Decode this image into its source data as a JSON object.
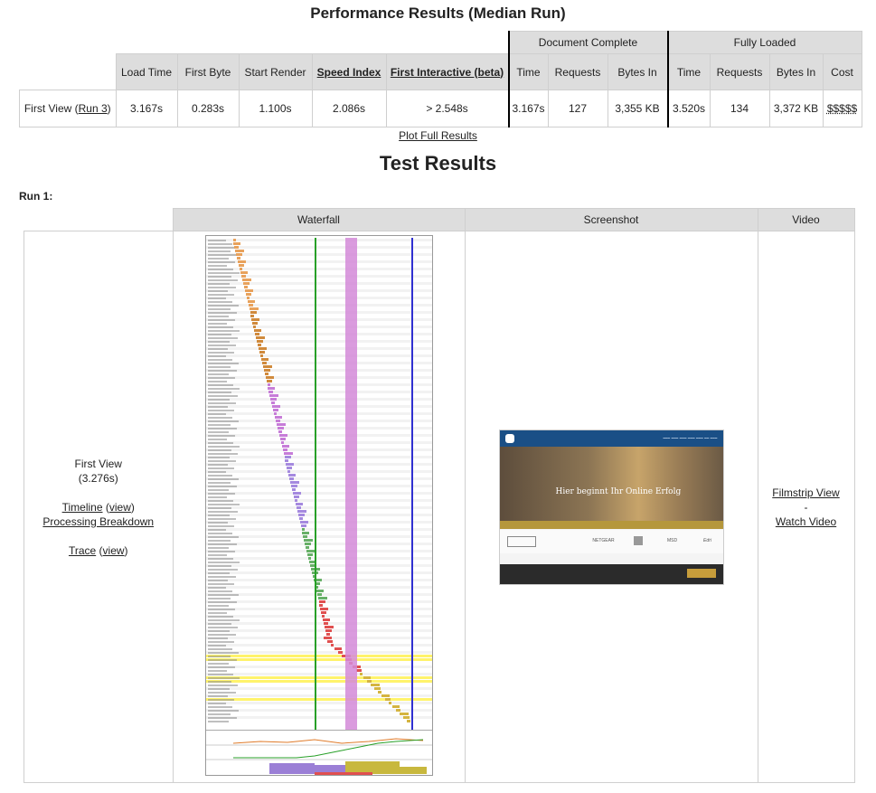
{
  "perf": {
    "title": "Performance Results (Median Run)",
    "group_document": "Document Complete",
    "group_fully": "Fully Loaded",
    "headers": {
      "load_time": "Load Time",
      "first_byte": "First Byte",
      "start_render": "Start Render",
      "speed_index": "Speed Index",
      "first_interactive": "First Interactive (beta)",
      "doc_time": "Time",
      "doc_requests": "Requests",
      "doc_bytes": "Bytes In",
      "fl_time": "Time",
      "fl_requests": "Requests",
      "fl_bytes": "Bytes In",
      "cost": "Cost"
    },
    "row": {
      "label_prefix": "First View (",
      "label_link": "Run 3",
      "label_suffix": ")",
      "load_time": "3.167s",
      "first_byte": "0.283s",
      "start_render": "1.100s",
      "speed_index": "2.086s",
      "first_interactive": "> 2.548s",
      "doc_time": "3.167s",
      "doc_requests": "127",
      "doc_bytes": "3,355 KB",
      "fl_time": "3.520s",
      "fl_requests": "134",
      "fl_bytes": "3,372 KB",
      "cost": "$$$$$"
    },
    "plot_link": "Plot Full Results"
  },
  "results": {
    "title": "Test Results",
    "run_label": "Run 1:",
    "col_waterfall": "Waterfall",
    "col_screenshot": "Screenshot",
    "col_video": "Video",
    "first_view": "First View",
    "first_view_time": "(3.276s)",
    "timeline": "Timeline",
    "view1": "view",
    "processing": "Processing Breakdown",
    "trace": "Trace",
    "view2": "view",
    "filmstrip": "Filmstrip View",
    "dash": "-",
    "watch_video": "Watch Video"
  },
  "screenshot": {
    "hero_text": "Hier beginnt Ihr Online Erfolg",
    "logos": [
      "NETGEAR",
      "MSD",
      "Edri"
    ]
  },
  "colors": {
    "header_bg": "#dddddd",
    "start_render_line": "#28a028",
    "speed_index_band": "#d48ad8",
    "doc_complete_line": "#3030d0",
    "highlight_row": "#fff36b"
  }
}
